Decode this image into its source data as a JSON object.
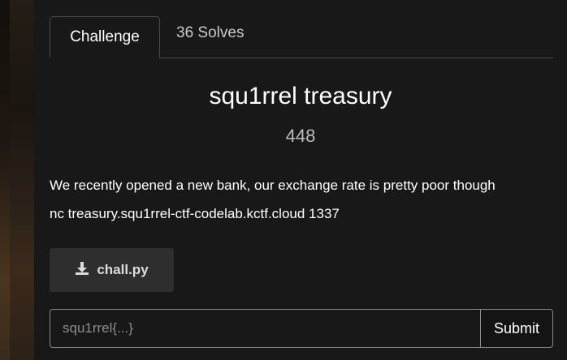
{
  "tabs": [
    {
      "label": "Challenge",
      "active": true
    },
    {
      "label": "36 Solves",
      "active": false
    }
  ],
  "challenge": {
    "name": "squ1rrel treasury",
    "points": "448",
    "description_lines": [
      "We recently opened a new bank, our exchange rate is pretty poor though",
      "nc treasury.squ1rrel-ctf-codelab.kctf.cloud 1337"
    ],
    "file": {
      "label": "chall.py",
      "icon": "download-icon"
    }
  },
  "flag_form": {
    "placeholder": "squ1rrel{...}",
    "value": "",
    "submit_label": "Submit"
  },
  "colors": {
    "background": "#181818",
    "file_button": "#2e2e2e",
    "border": "#8a8a8a"
  }
}
